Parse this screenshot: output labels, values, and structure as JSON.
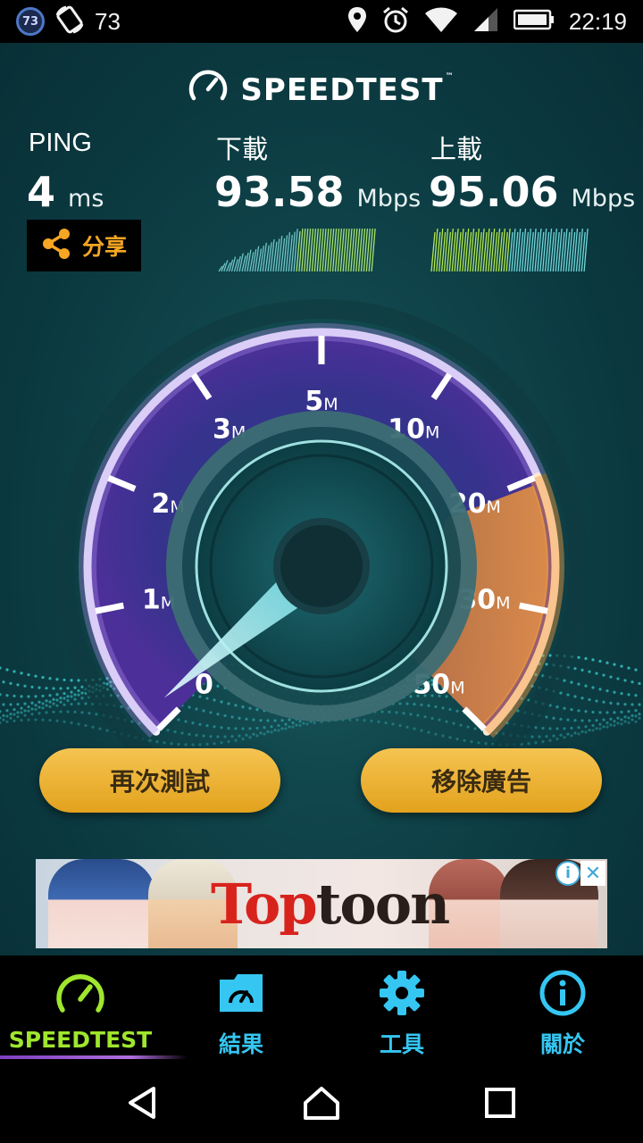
{
  "status_bar": {
    "badge": "73",
    "notification_count": "73",
    "time": "22:19",
    "icons": [
      "badge-73-icon",
      "sync-icon",
      "location-icon",
      "alarm-icon",
      "wifi-icon",
      "signal-icon",
      "battery-icon"
    ]
  },
  "header": {
    "title": "SPEEDTEST",
    "trademark": "™"
  },
  "ping": {
    "label": "PING",
    "value": "4",
    "unit": "ms"
  },
  "download": {
    "label": "下載",
    "value": "93.58",
    "unit": "Mbps"
  },
  "upload": {
    "label": "上載",
    "value": "95.06",
    "unit": "Mbps"
  },
  "share": {
    "label": "分享"
  },
  "gauge": {
    "ticks": [
      {
        "num": "0",
        "unit": ""
      },
      {
        "num": "1",
        "unit": "M"
      },
      {
        "num": "2",
        "unit": "M"
      },
      {
        "num": "3",
        "unit": "M"
      },
      {
        "num": "5",
        "unit": "M"
      },
      {
        "num": "10",
        "unit": "M"
      },
      {
        "num": "20",
        "unit": "M"
      },
      {
        "num": "30",
        "unit": "M"
      },
      {
        "num": "50",
        "unit": "M"
      }
    ]
  },
  "buttons": {
    "retest": "再次測試",
    "remove_ads": "移除廣告"
  },
  "ad": {
    "brand_first": "Top",
    "brand_rest": "toon",
    "info": "i",
    "close": "✕"
  },
  "tabs": [
    {
      "label": "SPEEDTEST",
      "icon": "speedometer-icon",
      "active": true
    },
    {
      "label": "結果",
      "icon": "results-folder-icon",
      "active": false
    },
    {
      "label": "工具",
      "icon": "gear-icon",
      "active": false
    },
    {
      "label": "關於",
      "icon": "info-icon",
      "active": false
    }
  ],
  "colors": {
    "accent_green": "#9fe62d",
    "tab_blue": "#35c6f2",
    "button_gold": "#e3a21d",
    "share_orange": "#f5a623",
    "gauge_purple": "#a98be8",
    "gauge_orange": "#f29a3e"
  }
}
